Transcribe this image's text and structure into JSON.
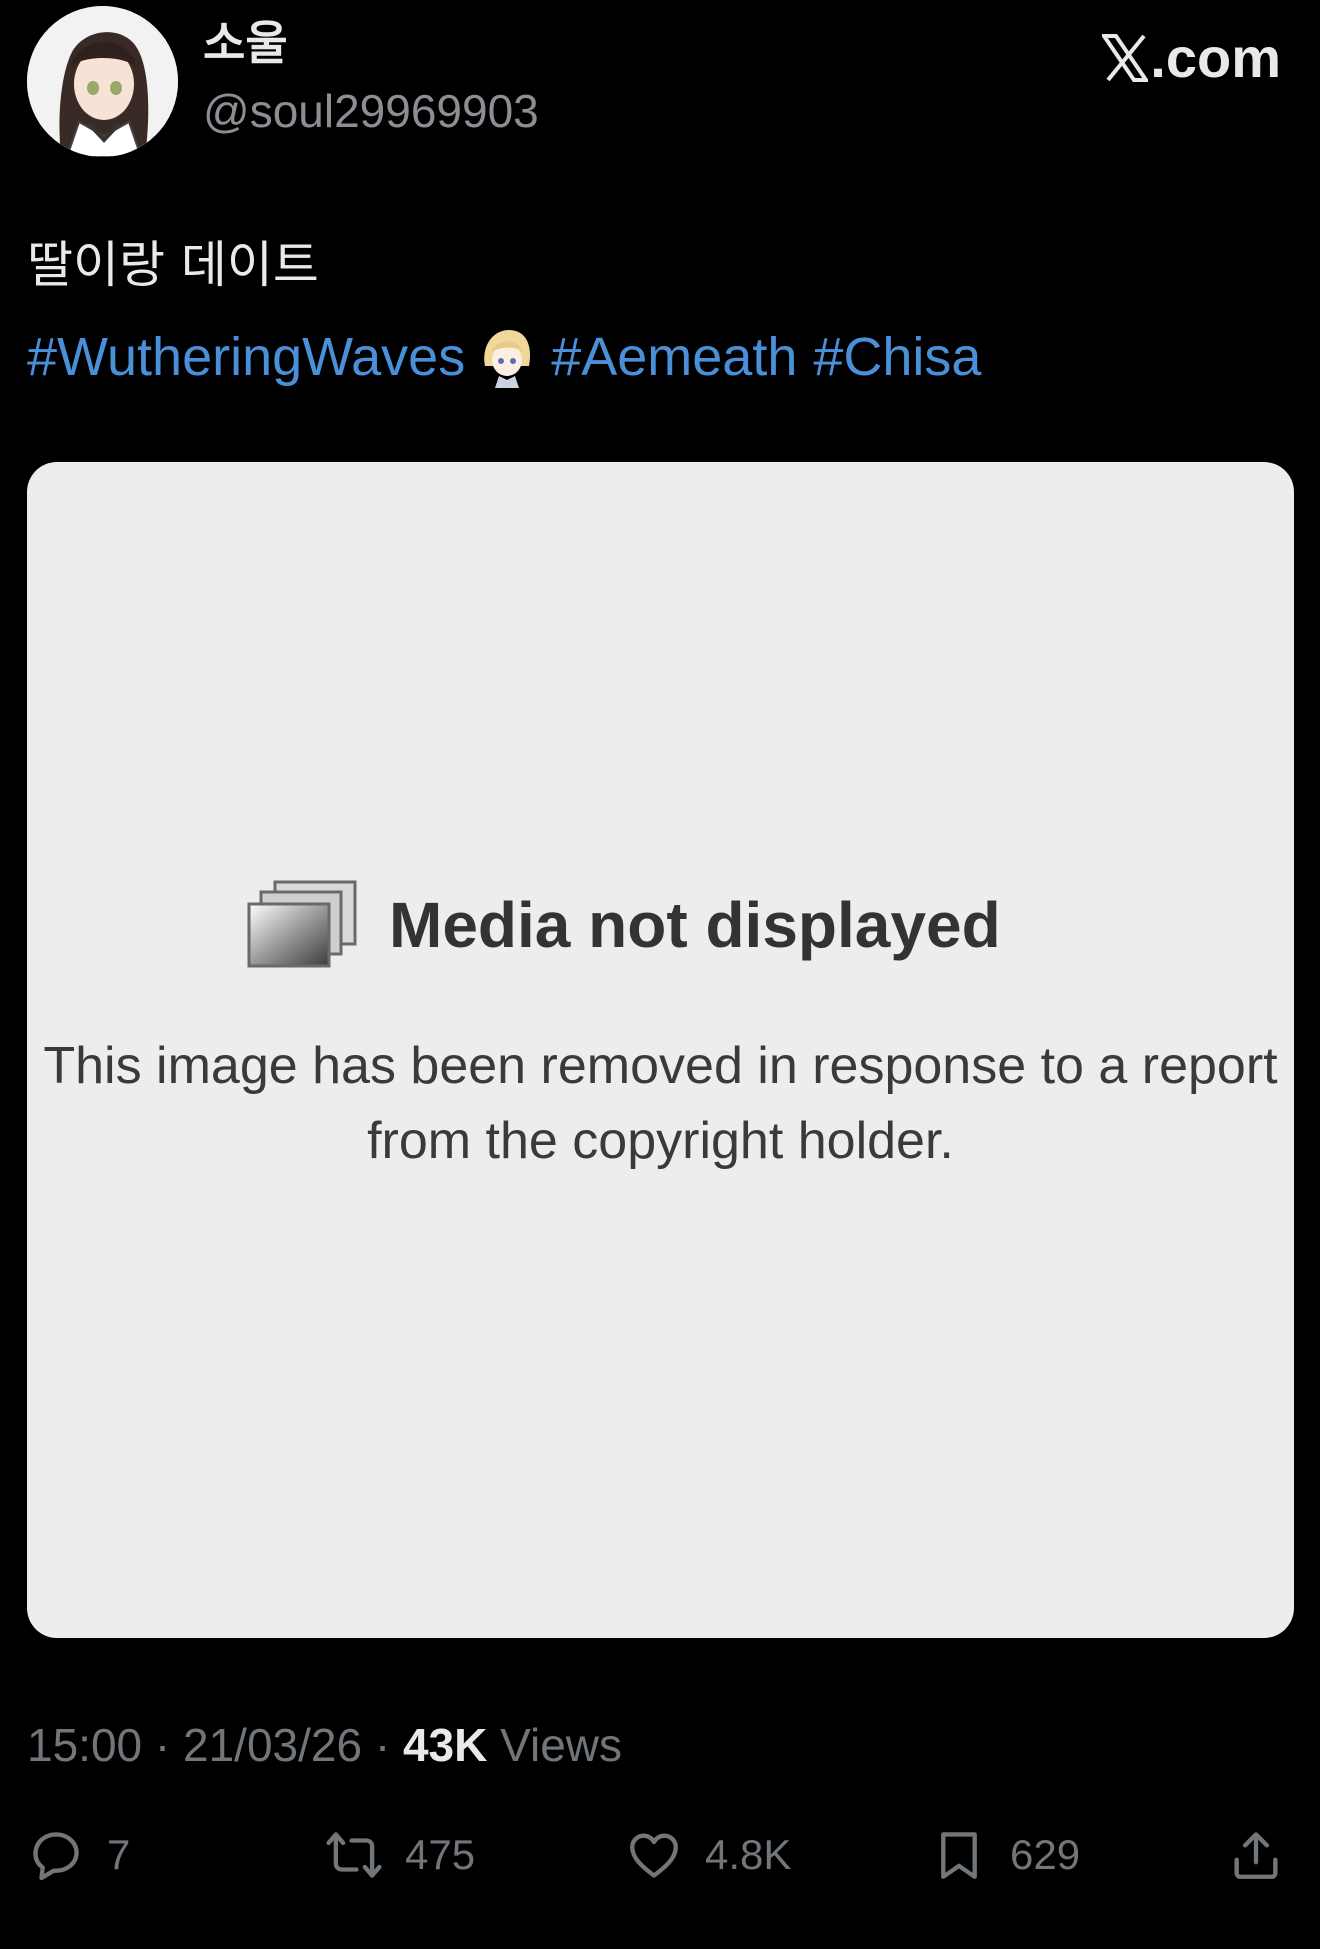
{
  "author": {
    "display_name": "소울",
    "handle": "@soul29969903"
  },
  "site": {
    "label": ".com",
    "logo_icon": "x-logo-icon"
  },
  "tweet": {
    "text": "딸이랑 데이트",
    "hashtags": [
      "#WutheringWaves",
      "#Aemeath",
      "#Chisa"
    ],
    "link_color": "#4a90d9"
  },
  "media": {
    "icon": "image-stack-icon",
    "title": "Media not displayed",
    "message": "This image has been removed in response to a report from the copyright holder.",
    "background": "#ededed"
  },
  "meta": {
    "time": "15:00",
    "date": "21/03/26",
    "separator": "·",
    "views_count": "43K",
    "views_label": "Views"
  },
  "actions": {
    "replies": "7",
    "reposts": "475",
    "likes": "4.8K",
    "bookmarks": "629"
  },
  "colors": {
    "background": "#000000",
    "text": "#e7e9ea",
    "muted": "#71767b"
  }
}
